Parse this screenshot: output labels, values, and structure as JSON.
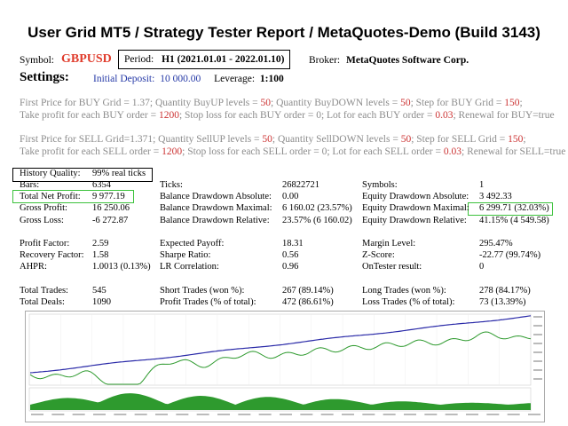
{
  "header": {
    "title": "User Grid MT5  /  Strategy Tester Report  /  MetaQuotes-Demo (Build 3143)"
  },
  "info": {
    "symbol_label": "Symbol:",
    "symbol_value": "GBPUSD",
    "period_label": "Period:",
    "period_value": "H1 (2021.01.01 - 2022.01.10)",
    "broker_label": "Broker:",
    "broker_value": "MetaQuotes Software Corp.",
    "settings_label": "Settings:",
    "deposit_label": "Initial Deposit:",
    "deposit_value": "10 000.00",
    "leverage_label": "Leverage:",
    "leverage_value": "1:100"
  },
  "params": {
    "buy1": [
      {
        "t": "First Price for BUY Grid = 1.37;  Quantity BuyUP levels = "
      },
      {
        "t": "50",
        "h": true
      },
      {
        "t": ";  Quantity BuyDOWN levels = "
      },
      {
        "t": "50",
        "h": true
      },
      {
        "t": ";  Step for BUY Grid = "
      },
      {
        "t": "150",
        "h": true
      },
      {
        "t": ";"
      }
    ],
    "buy2": [
      {
        "t": "Take profit for each BUY order = "
      },
      {
        "t": "1200",
        "h": true
      },
      {
        "t": ";  Stop loss for each BUY order = 0;  Lot for each BUY order = "
      },
      {
        "t": "0.03",
        "h": true
      },
      {
        "t": ";  Renewal for BUY=true"
      }
    ],
    "sell1": [
      {
        "t": "First Price for SELL Grid=1.371; Quantity SellUP levels = "
      },
      {
        "t": "50",
        "h": true
      },
      {
        "t": ";  Quantity SellDOWN levels = "
      },
      {
        "t": "50",
        "h": true
      },
      {
        "t": ";  Step for SELL Grid = "
      },
      {
        "t": "150",
        "h": true
      },
      {
        "t": ";"
      }
    ],
    "sell2": [
      {
        "t": "Take profit for each SELL order = "
      },
      {
        "t": "1200",
        "h": true
      },
      {
        "t": ";  Stop loss for each SELL order = 0;  Lot for each SELL order = "
      },
      {
        "t": "0.03",
        "h": true
      },
      {
        "t": ";  Renewal for SELL=true"
      }
    ]
  },
  "history_quality": {
    "label": "History Quality:",
    "value": "99% real ticks"
  },
  "stats": {
    "col1": [
      {
        "k": "Bars:",
        "v": "6354"
      },
      {
        "k": "Total Net Profit:",
        "v": "9 977.19"
      },
      {
        "k": "Gross Profit:",
        "v": "16 250.06"
      },
      {
        "k": "Gross Loss:",
        "v": "-6 272.87"
      },
      {
        "k": "",
        "v": ""
      },
      {
        "k": "Profit Factor:",
        "v": "2.59"
      },
      {
        "k": "Recovery Factor:",
        "v": "1.58"
      },
      {
        "k": "AHPR:",
        "v": "1.0013 (0.13%)"
      },
      {
        "k": "",
        "v": ""
      },
      {
        "k": "Total Trades:",
        "v": "545"
      },
      {
        "k": "Total Deals:",
        "v": "1090"
      }
    ],
    "col2": [
      {
        "k": "Ticks:",
        "v": "26822721"
      },
      {
        "k": "Balance Drawdown Absolute:",
        "v": "0.00"
      },
      {
        "k": "Balance Drawdown Maximal:",
        "v": "6 160.02 (23.57%)"
      },
      {
        "k": "Balance Drawdown Relative:",
        "v": "23.57% (6 160.02)"
      },
      {
        "k": "",
        "v": ""
      },
      {
        "k": "Expected Payoff:",
        "v": "18.31"
      },
      {
        "k": "Sharpe Ratio:",
        "v": "0.56"
      },
      {
        "k": "LR Correlation:",
        "v": "0.96"
      },
      {
        "k": "",
        "v": ""
      },
      {
        "k": "Short Trades (won %):",
        "v": "267 (89.14%)"
      },
      {
        "k": "Profit Trades (% of total):",
        "v": "472 (86.61%)"
      }
    ],
    "col3": [
      {
        "k": "Symbols:",
        "v": "1"
      },
      {
        "k": "Equity Drawdown Absolute:",
        "v": "3 492.33"
      },
      {
        "k": "Equity Drawdown Maximal:",
        "v": "6 299.71 (32.03%)"
      },
      {
        "k": "Equity Drawdown Relative:",
        "v": "41.15% (4 549.58)"
      },
      {
        "k": "",
        "v": ""
      },
      {
        "k": "Margin Level:",
        "v": "295.47%"
      },
      {
        "k": "Z-Score:",
        "v": "-22.77 (99.74%)"
      },
      {
        "k": "OnTester result:",
        "v": "0"
      },
      {
        "k": "",
        "v": ""
      },
      {
        "k": "Long Trades (won %):",
        "v": "278 (84.17%)"
      },
      {
        "k": "Loss Trades (% of total):",
        "v": "73 (13.39%)"
      }
    ]
  },
  "colors": {
    "balance": "#2a2aa8",
    "equity": "#2e9a2e",
    "deposit": "#2e9a2e",
    "highlight": "#cc3333",
    "box_green": "#3cc23c"
  }
}
